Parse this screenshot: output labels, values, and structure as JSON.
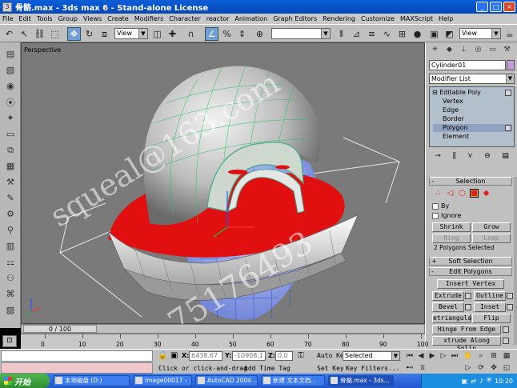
{
  "window": {
    "title": "骨骼.max - 3ds max 6 - Stand-alone License",
    "controls": [
      "_",
      "□",
      "×"
    ]
  },
  "menu": [
    "File",
    "Edit",
    "Tools",
    "Group",
    "Views",
    "Create",
    "Modifiers",
    "Character",
    "reactor",
    "Animation",
    "Graph Editors",
    "Rendering",
    "Customize",
    "MAXScript",
    "Help"
  ],
  "toolbar": {
    "ref_coord": "View",
    "view_dropdown": "View"
  },
  "viewport": {
    "label": "Perspective"
  },
  "watermarks": [
    "squeal@163.com",
    "QQ:75176493",
    "squeal@163.com",
    "QQ:75176493"
  ],
  "command_panel": {
    "object_name": "Cylinder01",
    "object_color": "#c59cd8",
    "modifier_list": "Modifier List",
    "stack": {
      "root": "Editable Poly",
      "items": [
        "Vertex",
        "Edge",
        "Border",
        "Polygon",
        "Element"
      ],
      "selected": "Polygon"
    },
    "selection": {
      "title": "Selection",
      "by_label": "By",
      "ignore_label": "Ignore",
      "shrink": "Shrink",
      "grow": "Grow",
      "ring": "Ring",
      "loop": "Loop",
      "info": "2 Polygons Selected"
    },
    "soft_selection": {
      "title": "Soft Selection"
    },
    "edit_polygons": {
      "title": "Edit Polygons",
      "insert_vertex": "Insert Vertex",
      "extrude": "Extrude",
      "outline": "Outline",
      "bevel": "Bevel",
      "inset": "Inset",
      "retriangulate": "etriangula",
      "flip": "Flip",
      "hinge": "Hinge From Edge",
      "extrude_along": "xtrude Along Splin"
    }
  },
  "time": {
    "slider": "0 / 100",
    "ticks": [
      0,
      10,
      20,
      30,
      40,
      50,
      60,
      70,
      80,
      90,
      100
    ]
  },
  "status": {
    "x_label": "X:",
    "x_value": "6438.67",
    "y_label": "Y:",
    "y_value": "-10908.1",
    "z_label": "Z:",
    "z_value": "0.0",
    "prompt": "Click or click-and-drag",
    "add_time_tag": "Add Time Tag",
    "auto_key": "Auto Key",
    "selection_set": "Selected",
    "set_key": "Set Key",
    "key_filters": "Key Filters..."
  },
  "taskbar": {
    "start": "开始",
    "tasks": [
      "本地磁盘 (D:)",
      "Image00017 - ...",
      "AutoCAD 2004 ...",
      "新建 文本文档...",
      "骨骼.max - 3ds..."
    ],
    "clock": "10:20"
  }
}
